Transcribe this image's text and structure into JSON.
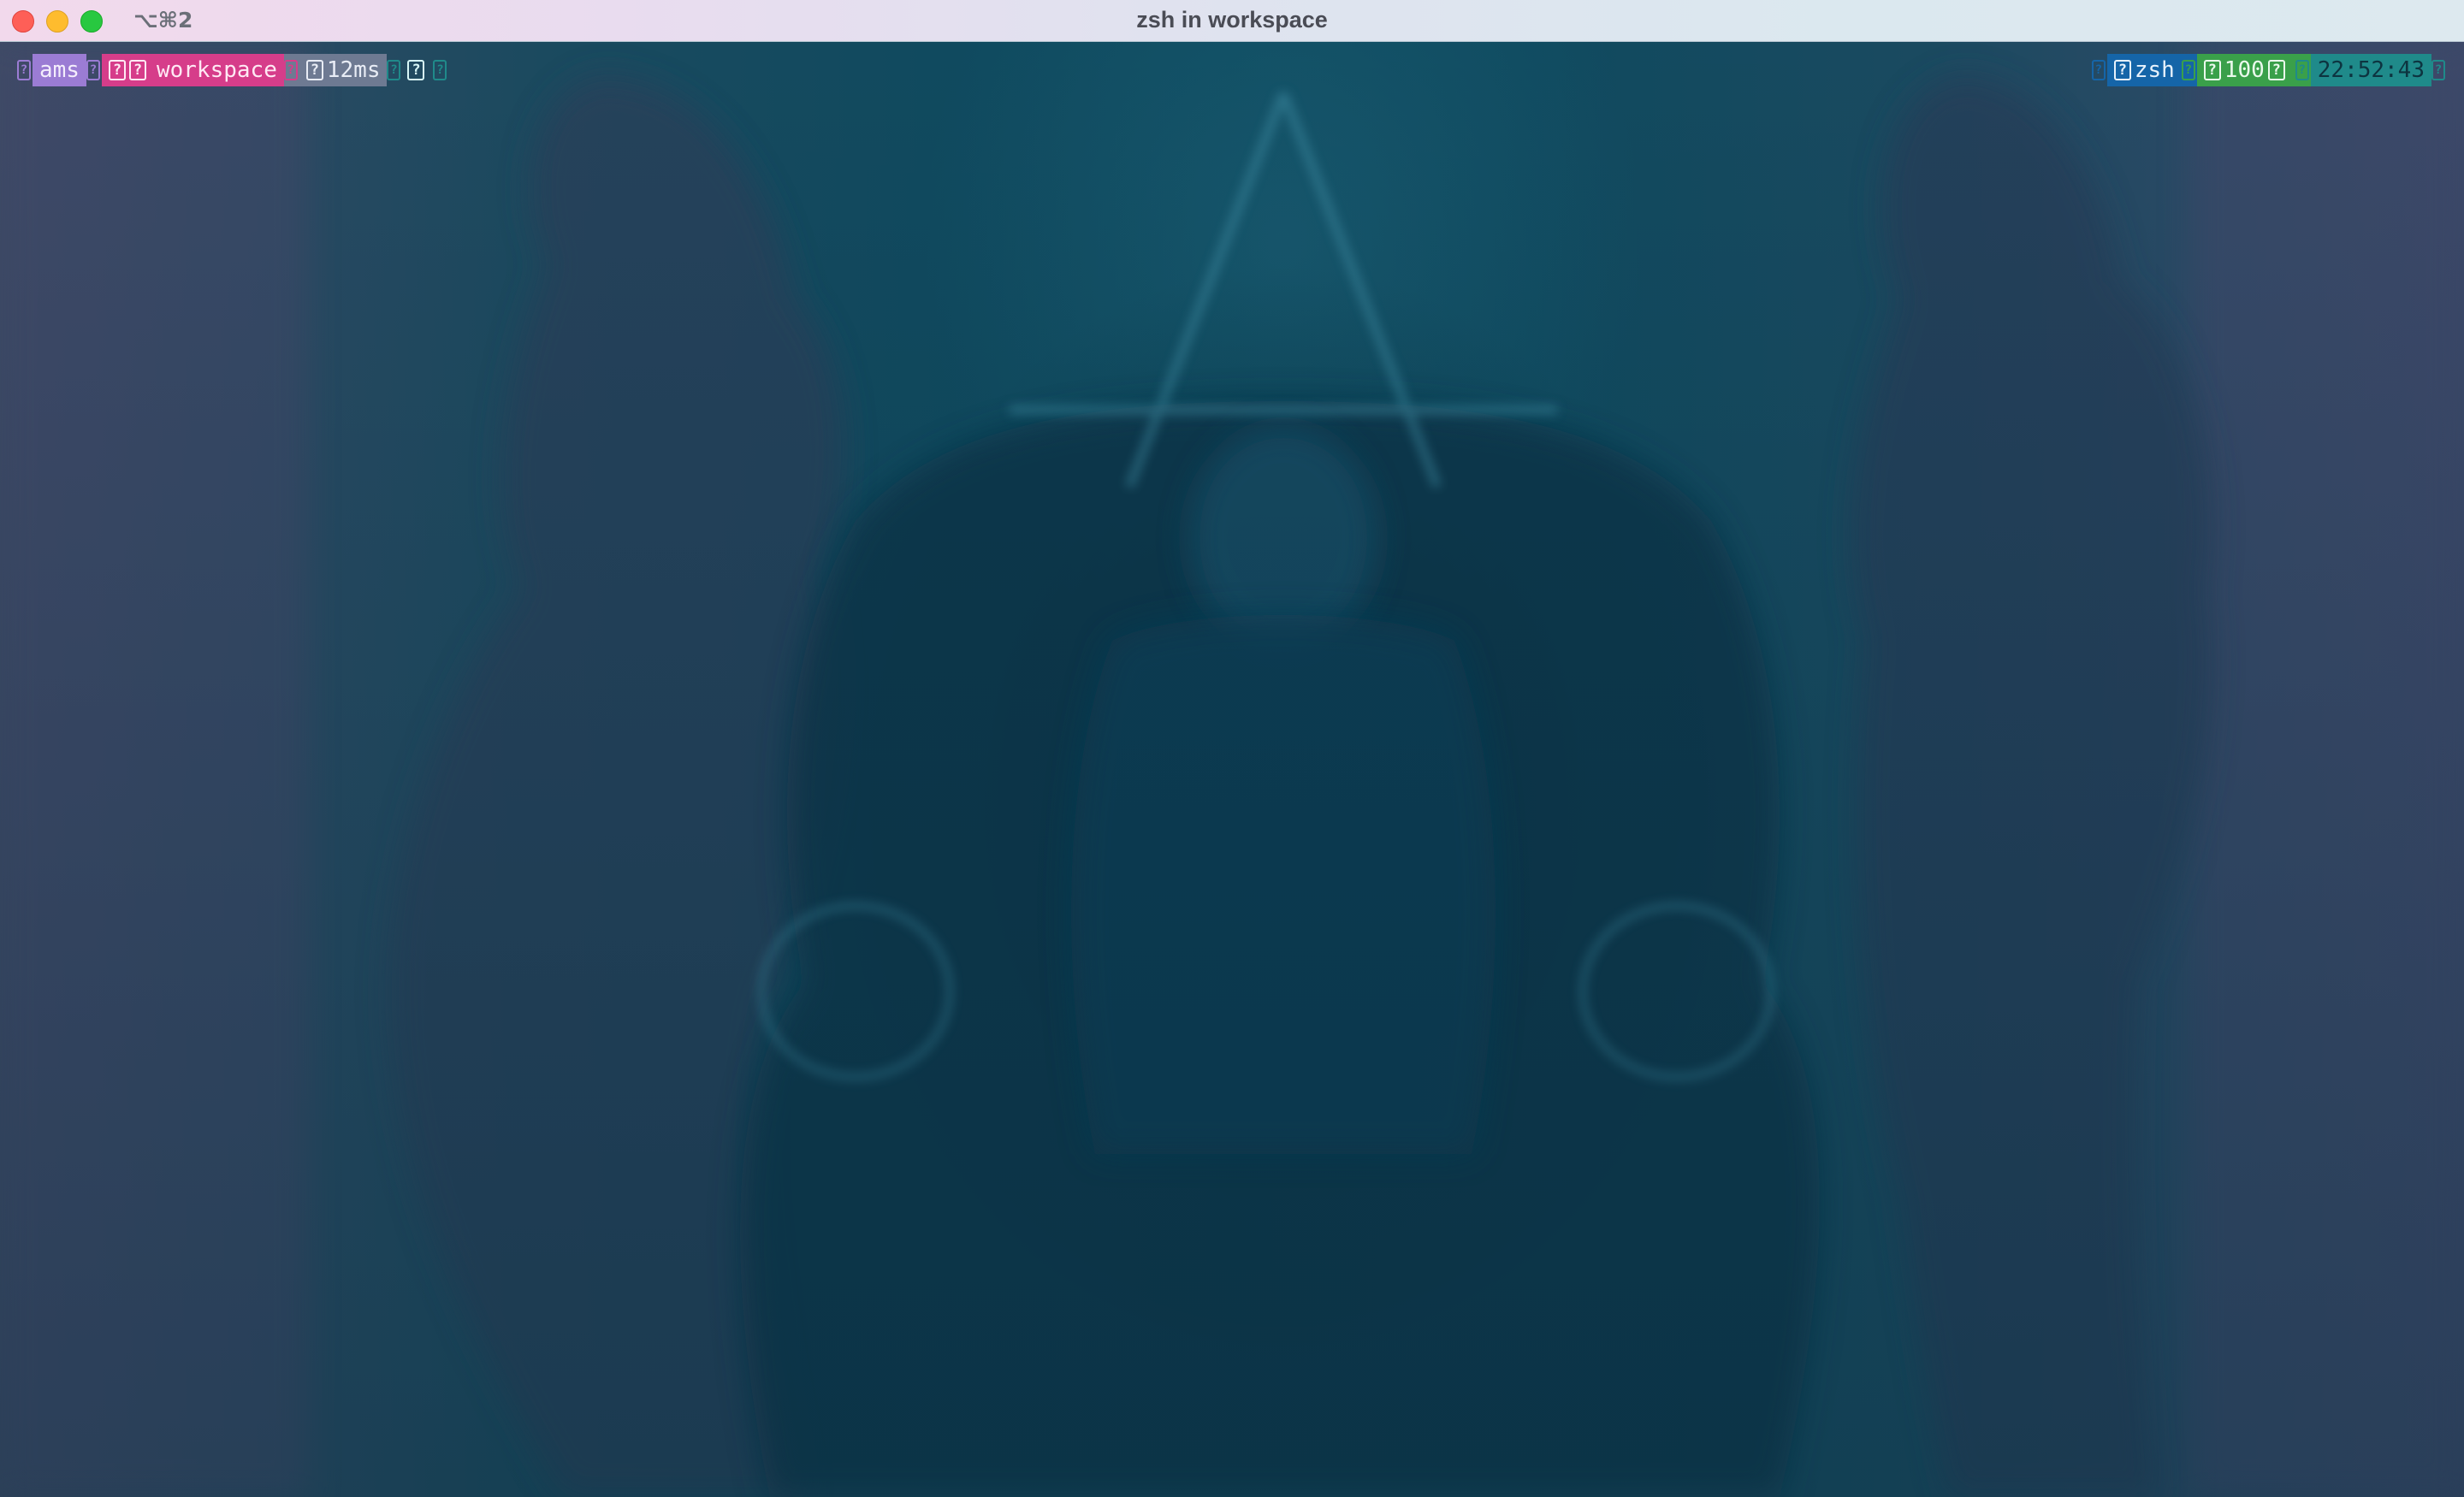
{
  "window": {
    "shortcut": "⌥⌘2",
    "title": "zsh in workspace"
  },
  "prompt": {
    "left": {
      "user": "ams",
      "directory": "workspace",
      "duration": "12ms"
    },
    "right": {
      "shell": "zsh",
      "battery": "100",
      "time": "22:52:43"
    },
    "glyph": "?"
  },
  "colors": {
    "user_bg": "#9b7cd4",
    "dir_bg": "#d63d8a",
    "duration_bg": "#6e7a92",
    "shell_bg": "#1565a8",
    "battery_bg": "#3aa04a",
    "time_bg": "#1f8a8a"
  }
}
